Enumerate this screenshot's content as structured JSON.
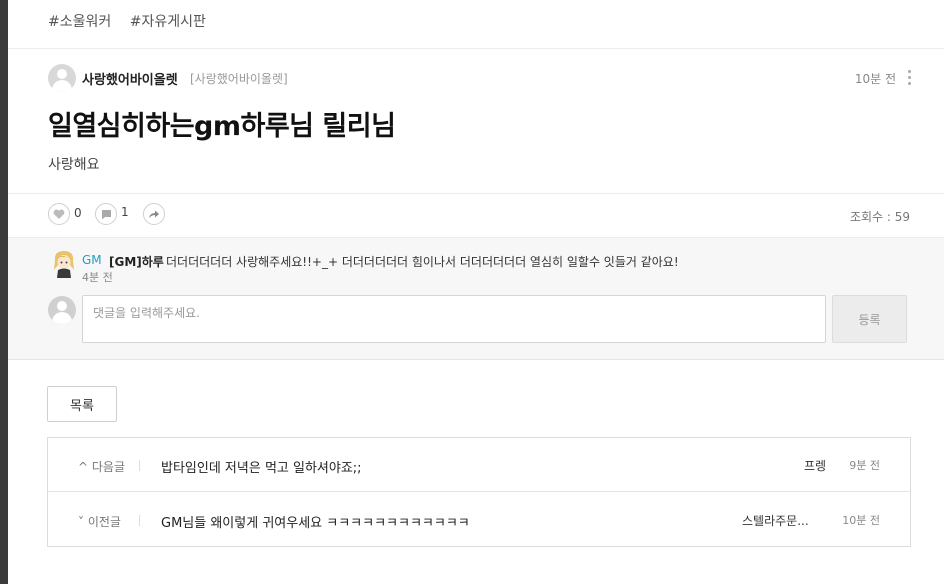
{
  "tags": [
    "#소울워커",
    "#자유게시판"
  ],
  "post": {
    "author_name": "사랑했어바이올렛",
    "author_id": "[사랑했어바이올렛]",
    "time": "10분 전",
    "title": "일열심히하는gm하루님 릴리님",
    "body": "사랑해요",
    "likes": "0",
    "comments": "1",
    "views": "조회수 : 59"
  },
  "comment": {
    "author": "GM",
    "nickname": "[GM]하루",
    "text": "더더더더더더 사랑해주세요!!+_+ 더더더더더더 힘이나서 더더더더더더 열심히 일할수 잇들거 같아요!",
    "time": "4분 전"
  },
  "comment_input": {
    "placeholder": "댓글을 입력해주세요.",
    "submit_label": "등록"
  },
  "list_button": "목록",
  "navigation": [
    {
      "direction": "^ 다음글",
      "title": "밥타임인데 저녁은 먹고 일하셔야죠;;",
      "writer": "프렝",
      "time": "9분 전"
    },
    {
      "direction": "˅ 이전글",
      "title": "GM님들 왜이렇게 귀여우세요 ㅋㅋㅋㅋㅋㅋㅋㅋㅋㅋㅋㅋ",
      "writer": "스텔라주문...",
      "time": "10분 전"
    }
  ],
  "colors": {
    "accent": "#1da1c8",
    "left_bar": "#3b3b3b",
    "comment_bg": "#f7f7f7"
  },
  "icons": [
    "heart-icon",
    "comment-icon",
    "share-icon",
    "more-vertical-icon",
    "avatar-icon"
  ]
}
